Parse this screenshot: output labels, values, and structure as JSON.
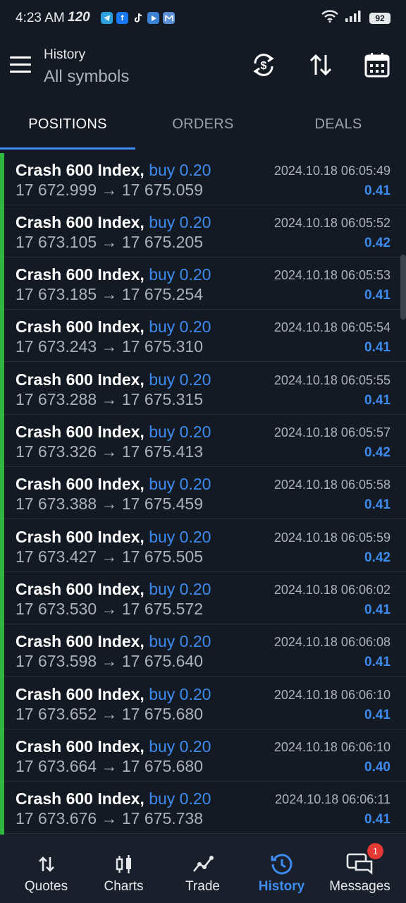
{
  "status_bar": {
    "time": "4:23 AM",
    "refresh_rate": "120",
    "battery": "92",
    "apps": [
      "telegram-icon",
      "facebook-icon",
      "tiktok-icon",
      "youtube-icon",
      "gmail-icon"
    ]
  },
  "header": {
    "title": "History",
    "subtitle": "All symbols"
  },
  "tabs": [
    {
      "label": "POSITIONS",
      "active": true
    },
    {
      "label": "ORDERS",
      "active": false
    },
    {
      "label": "DEALS",
      "active": false
    }
  ],
  "positions": [
    {
      "symbol": "Crash 600 Index,",
      "side": "buy 0.20",
      "prices": "17 672.999 → 17 675.059",
      "time": "2024.10.18 06:05:49",
      "profit": "0.41"
    },
    {
      "symbol": "Crash 600 Index,",
      "side": "buy 0.20",
      "prices": "17 673.105 → 17 675.205",
      "time": "2024.10.18 06:05:52",
      "profit": "0.42"
    },
    {
      "symbol": "Crash 600 Index,",
      "side": "buy 0.20",
      "prices": "17 673.185 → 17 675.254",
      "time": "2024.10.18 06:05:53",
      "profit": "0.41"
    },
    {
      "symbol": "Crash 600 Index,",
      "side": "buy 0.20",
      "prices": "17 673.243 → 17 675.310",
      "time": "2024.10.18 06:05:54",
      "profit": "0.41"
    },
    {
      "symbol": "Crash 600 Index,",
      "side": "buy 0.20",
      "prices": "17 673.288 → 17 675.315",
      "time": "2024.10.18 06:05:55",
      "profit": "0.41"
    },
    {
      "symbol": "Crash 600 Index,",
      "side": "buy 0.20",
      "prices": "17 673.326 → 17 675.413",
      "time": "2024.10.18 06:05:57",
      "profit": "0.42"
    },
    {
      "symbol": "Crash 600 Index,",
      "side": "buy 0.20",
      "prices": "17 673.388 → 17 675.459",
      "time": "2024.10.18 06:05:58",
      "profit": "0.41"
    },
    {
      "symbol": "Crash 600 Index,",
      "side": "buy 0.20",
      "prices": "17 673.427 → 17 675.505",
      "time": "2024.10.18 06:05:59",
      "profit": "0.42"
    },
    {
      "symbol": "Crash 600 Index,",
      "side": "buy 0.20",
      "prices": "17 673.530 → 17 675.572",
      "time": "2024.10.18 06:06:02",
      "profit": "0.41"
    },
    {
      "symbol": "Crash 600 Index,",
      "side": "buy 0.20",
      "prices": "17 673.598 → 17 675.640",
      "time": "2024.10.18 06:06:08",
      "profit": "0.41"
    },
    {
      "symbol": "Crash 600 Index,",
      "side": "buy 0.20",
      "prices": "17 673.652 → 17 675.680",
      "time": "2024.10.18 06:06:10",
      "profit": "0.41"
    },
    {
      "symbol": "Crash 600 Index,",
      "side": "buy 0.20",
      "prices": "17 673.664 → 17 675.680",
      "time": "2024.10.18 06:06:10",
      "profit": "0.40"
    },
    {
      "symbol": "Crash 600 Index,",
      "side": "buy 0.20",
      "prices": "17 673.676 → 17 675.738",
      "time": "2024.10.18 06:06:11",
      "profit": "0.41"
    }
  ],
  "bottom_nav": [
    {
      "label": "Quotes",
      "icon": "quotes-icon"
    },
    {
      "label": "Charts",
      "icon": "charts-icon"
    },
    {
      "label": "Trade",
      "icon": "trade-icon"
    },
    {
      "label": "History",
      "icon": "history-icon",
      "active": true
    },
    {
      "label": "Messages",
      "icon": "messages-icon",
      "badge": "1"
    }
  ],
  "colors": {
    "background": "#141a24",
    "accent": "#3e8bf0",
    "buy_bar": "#2fb640",
    "badge": "#e53935"
  }
}
